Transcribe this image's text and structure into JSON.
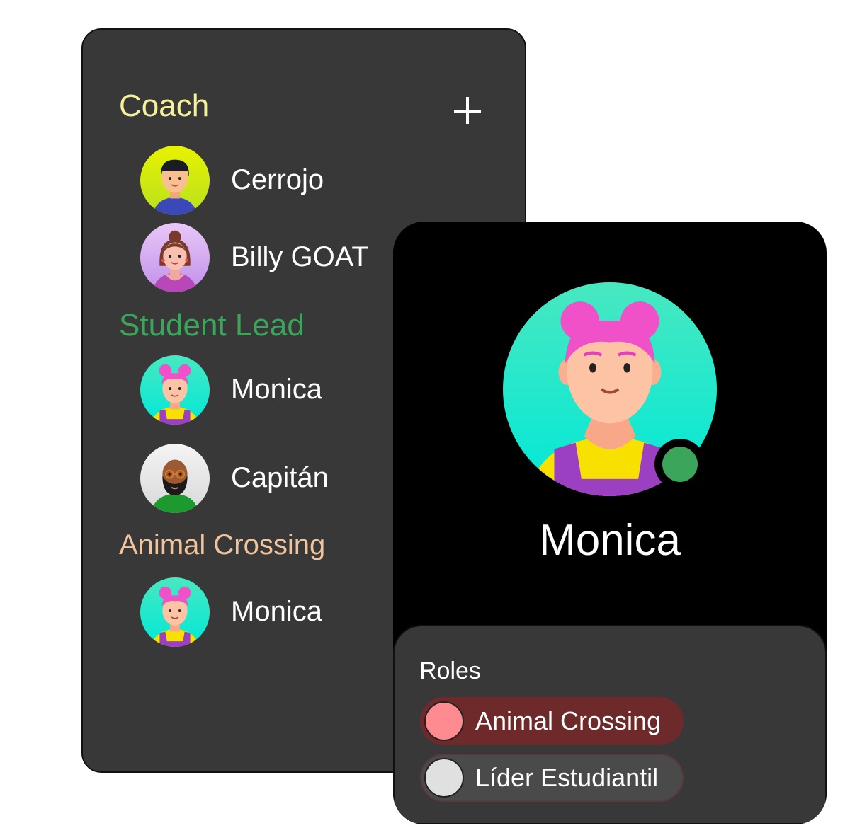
{
  "colors": {
    "coach": "#f5f09a",
    "student_lead": "#3ba55c",
    "animal_crossing": "#f0c49c",
    "online_status": "#3ba55c",
    "role_animal_crossing_bg": "#6e2a2a",
    "role_animal_crossing_dot": "#ff8a8f",
    "role_lider_bg": "#4a4a4a",
    "role_lider_dot": "#e0e0e0"
  },
  "member_list": {
    "add_icon": "plus-icon",
    "groups": [
      {
        "title": "Coach",
        "members": [
          {
            "name": "Cerrojo",
            "avatar": "boy-avatar"
          },
          {
            "name": "Billy GOAT",
            "avatar": "woman-avatar"
          }
        ]
      },
      {
        "title": "Student Lead",
        "members": [
          {
            "name": "Monica",
            "avatar": "girl-pink-hair-avatar"
          },
          {
            "name": "Capitán",
            "avatar": "bearded-man-avatar"
          }
        ]
      },
      {
        "title": "Animal Crossing",
        "members": [
          {
            "name": "Monica",
            "avatar": "girl-pink-hair-avatar"
          }
        ]
      }
    ]
  },
  "profile": {
    "name": "Monica",
    "status": "online",
    "roles_label": "Roles",
    "roles": [
      {
        "name": "Animal Crossing"
      },
      {
        "name": "Líder Estudiantil"
      }
    ]
  }
}
